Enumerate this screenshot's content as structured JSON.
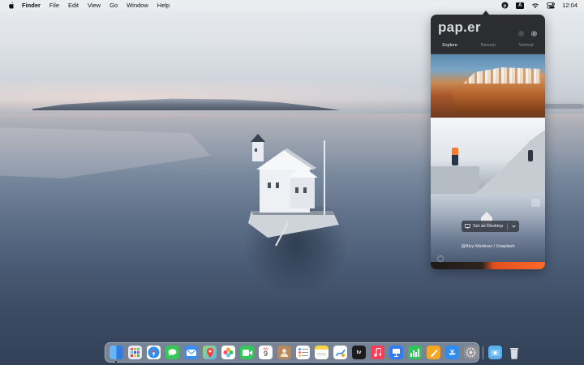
{
  "menubar": {
    "app_name": "Finder",
    "menus": [
      "File",
      "Edit",
      "View",
      "Go",
      "Window",
      "Help"
    ],
    "clock": "12:04",
    "tray_icons": [
      "paper-app-icon",
      "input-source-icon",
      "wifi-icon",
      "control-center-icon"
    ],
    "input_source_label": "A"
  },
  "popover": {
    "logo": "pap.er",
    "tabs": [
      {
        "label": "Explore",
        "active": true
      },
      {
        "label": "Newest",
        "active": false
      },
      {
        "label": "Vertical",
        "active": false
      }
    ],
    "set_desktop_label": "Set as Desktop",
    "credit": "@Alvy Martinez / Unsplash"
  },
  "dock": {
    "calendar_day": "JUL",
    "calendar_date": "9",
    "apple_tv_label": "tv",
    "apps": [
      {
        "name": "finder",
        "color": "#3d8ef0"
      },
      {
        "name": "launchpad",
        "color": "#e8635a"
      },
      {
        "name": "safari",
        "color": "#2f8ff1"
      },
      {
        "name": "messages",
        "color": "#35c759"
      },
      {
        "name": "mail",
        "color": "#3a8df3"
      },
      {
        "name": "maps",
        "color": "#6cc070"
      },
      {
        "name": "photos",
        "color": "#f2c94c"
      },
      {
        "name": "facetime",
        "color": "#34c759"
      },
      {
        "name": "calendar",
        "color": "#ffffff"
      },
      {
        "name": "contacts",
        "color": "#b58a61"
      },
      {
        "name": "reminders",
        "color": "#ffffff"
      },
      {
        "name": "notes",
        "color": "#f7d64a"
      },
      {
        "name": "freeform",
        "color": "#ffffff"
      },
      {
        "name": "apple-tv",
        "color": "#1c1c1e"
      },
      {
        "name": "music",
        "color": "#fa3c55"
      },
      {
        "name": "keynote",
        "color": "#2f7cf6"
      },
      {
        "name": "numbers",
        "color": "#30c45a"
      },
      {
        "name": "pages",
        "color": "#f5a623"
      },
      {
        "name": "app-store",
        "color": "#2d8cf0"
      },
      {
        "name": "system-settings",
        "color": "#8e8e93"
      },
      {
        "name": "downloads-folder",
        "color": "#5ab0ea"
      },
      {
        "name": "trash",
        "color": "#d9dde2"
      }
    ]
  }
}
